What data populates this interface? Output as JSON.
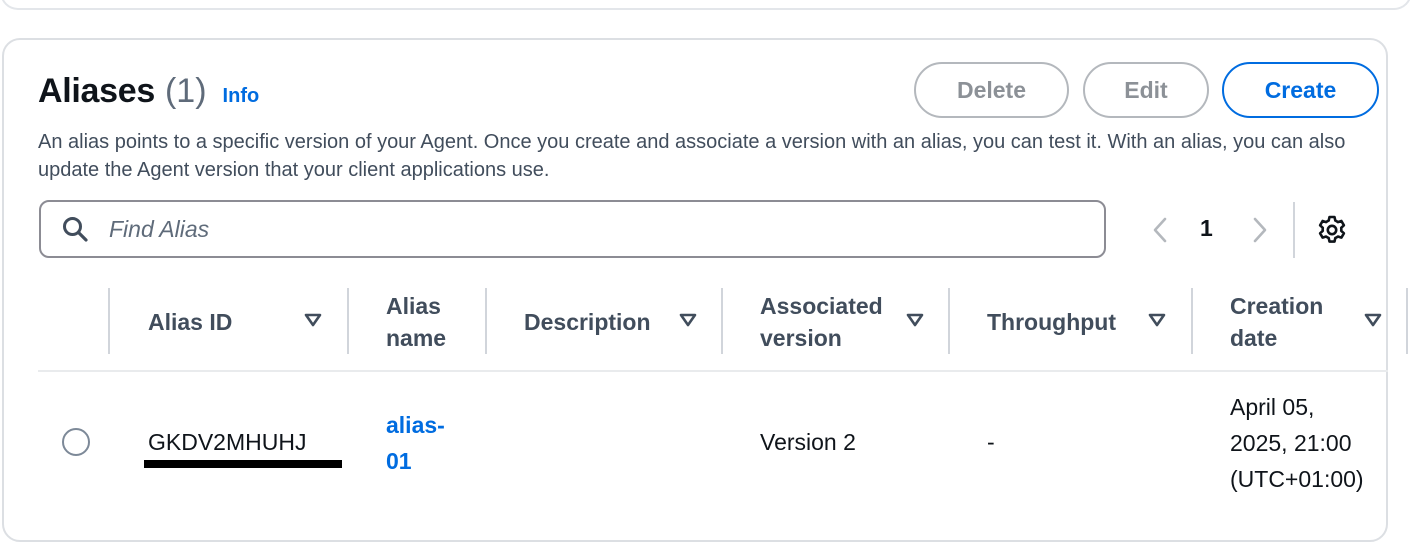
{
  "header": {
    "title": "Aliases",
    "count": "(1)",
    "info": "Info",
    "description": "An alias points to a specific version of your Agent. Once you create and associate a version with an alias, you can test it. With an alias, you can also update the Agent version that your client applications use."
  },
  "actions": {
    "delete": "Delete",
    "edit": "Edit",
    "create": "Create"
  },
  "search": {
    "placeholder": "Find Alias",
    "value": ""
  },
  "pagination": {
    "current_page": "1"
  },
  "table": {
    "columns": {
      "alias_id": "Alias ID",
      "alias_name_1": "Alias",
      "alias_name_2": "name",
      "description": "Description",
      "associated_version_1": "Associated",
      "associated_version_2": "version",
      "throughput": "Throughput",
      "creation_date_1": "Creation",
      "creation_date_2": "date"
    },
    "rows": [
      {
        "alias_id": "GKDV2MHUHJ",
        "alias_name_1": "alias-",
        "alias_name_2": "01",
        "description": "",
        "associated_version": "Version 2",
        "throughput": "-",
        "creation_date_1": "April 05,",
        "creation_date_2": "2025, 21:00",
        "creation_date_3": "(UTC+01:00)"
      }
    ]
  },
  "colors": {
    "accent": "#006ce0",
    "disabled": "#8c9197",
    "border": "#dcdfe3"
  },
  "icons": [
    "search-icon",
    "chevron-left-icon",
    "chevron-right-icon",
    "gear-icon",
    "sort-down-icon",
    "radio-icon"
  ]
}
